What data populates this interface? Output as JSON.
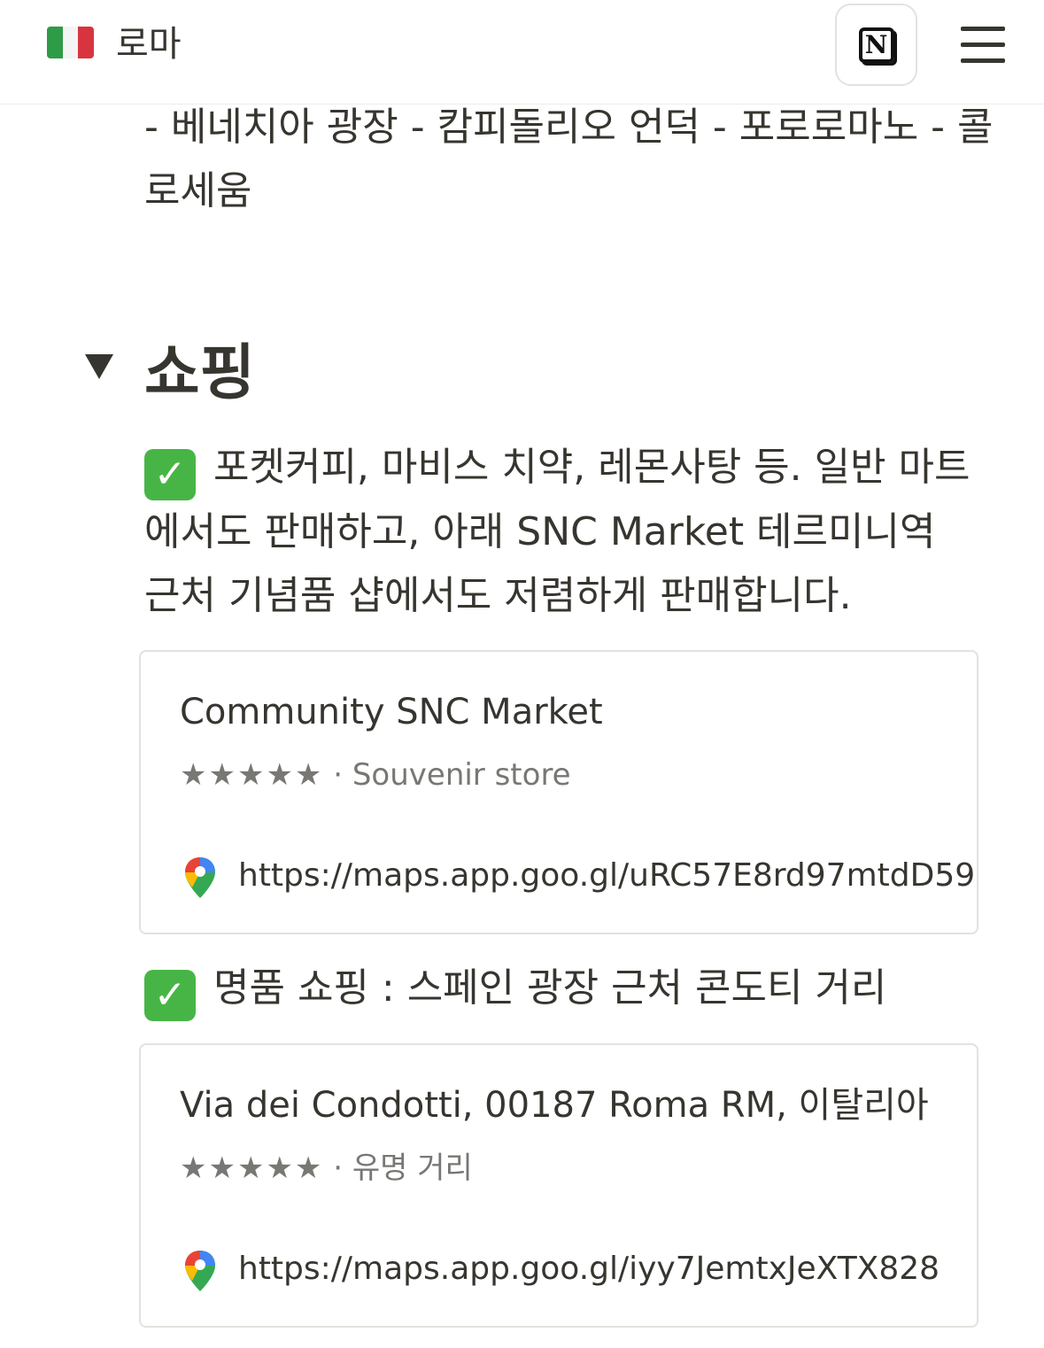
{
  "header": {
    "flag_icon": "italy-flag",
    "title": "로마",
    "notion_logo_letter": "N",
    "menu_icon": "hamburger-menu-icon"
  },
  "route": {
    "text": "- 베네치아 광장 - 캄피돌리오 언덕 - 포로로마노 - 콜로세움"
  },
  "shopping": {
    "heading": "쇼핑",
    "toggle_icon": "triangle-down-icon",
    "item1_check": "✓",
    "item1_text": "포켓커피, 마비스 치약, 레몬사탕 등. 일반 마트에서도 판매하고, 아래 SNC Market 테르미니역 근처 기념품 샵에서도 저렴하게 판매합니다.",
    "card1": {
      "title": "Community SNC Market",
      "stars": "★★★★★",
      "separator": "·",
      "category": "Souvenir store",
      "url": "https://maps.app.goo.gl/uRC57E8rd97mtdD59"
    },
    "item2_check": "✓",
    "item2_text": "명품 쇼핑 : 스페인 광장 근처 콘도티 거리",
    "card2": {
      "title": "Via dei Condotti, 00187 Roma RM, 이탈리아",
      "stars": "★★★★★",
      "separator": "·",
      "category": "유명 거리",
      "url": "https://maps.app.goo.gl/iyy7JemtxJeXTX828"
    }
  },
  "colors": {
    "text": "#37352f",
    "muted": "#787774",
    "border": "#e3e2de",
    "check_green": "#47b546"
  }
}
